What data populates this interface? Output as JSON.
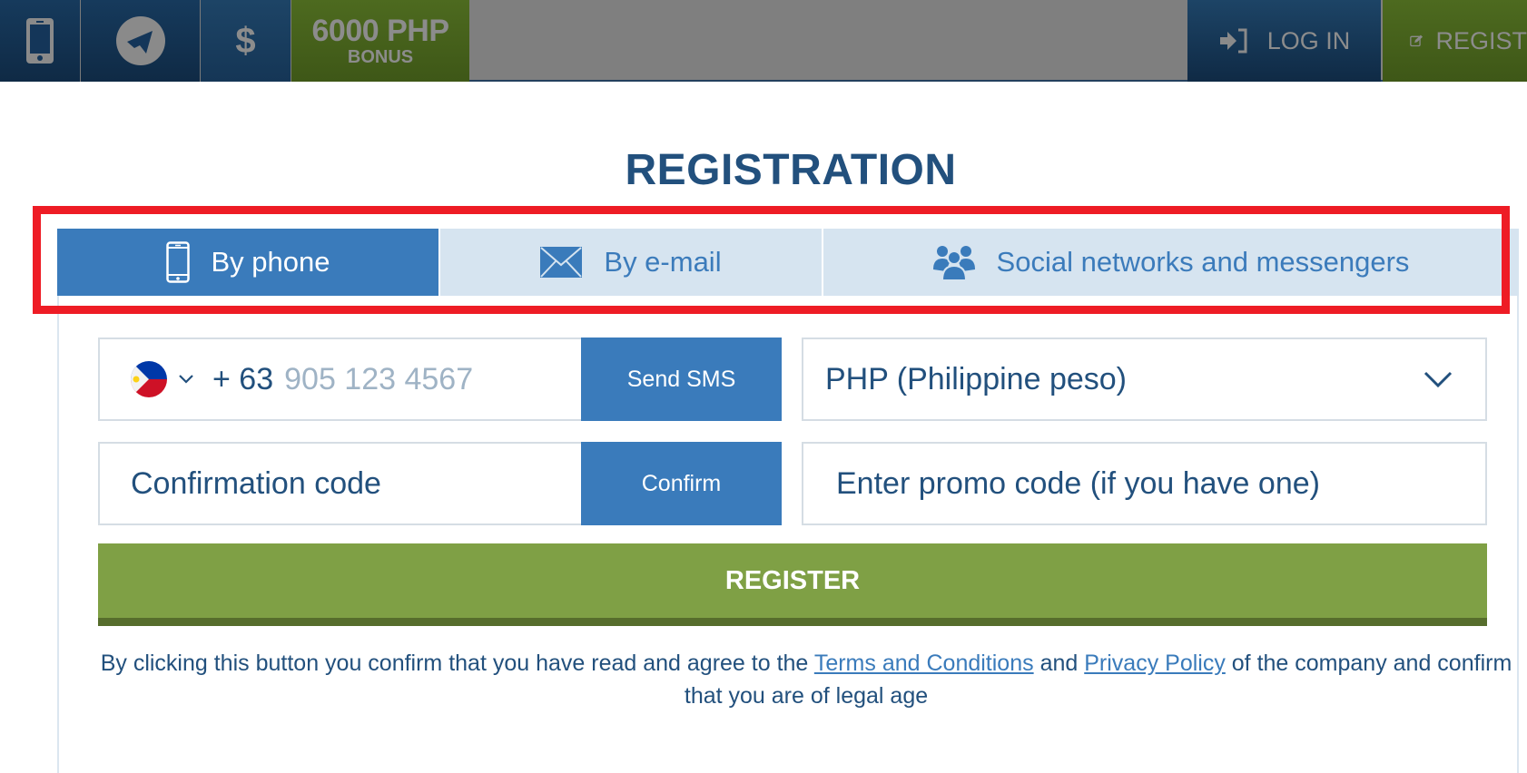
{
  "header": {
    "phone_app_icon": "mobile-phone-icon",
    "telegram_icon": "telegram-icon",
    "dollar_symbol": "$",
    "bonus_amount": "6000 PHP",
    "bonus_label": "BONUS",
    "login_label": "LOG IN",
    "register_label": "REGIST"
  },
  "page": {
    "title": "REGISTRATION"
  },
  "tabs": [
    {
      "label": "By phone",
      "icon": "smartphone-icon",
      "active": true
    },
    {
      "label": "By e-mail",
      "icon": "envelope-icon",
      "active": false
    },
    {
      "label": "Social networks and messengers",
      "icon": "users-icon",
      "active": false
    }
  ],
  "form": {
    "phone": {
      "country": "Philippines",
      "country_code": "+ 63",
      "placeholder": "905 123 4567",
      "send_sms_label": "Send SMS"
    },
    "confirmation": {
      "placeholder": "Confirmation code",
      "confirm_label": "Confirm"
    },
    "currency": {
      "selected": "PHP (Philippine peso)"
    },
    "promo": {
      "placeholder": "Enter promo code (if you have one)"
    },
    "register_label": "REGISTER"
  },
  "terms": {
    "prefix": "By clicking this button you confirm that you have read and agree to the ",
    "terms_link": "Terms and Conditions",
    "middle": " and ",
    "privacy_link": "Privacy Policy",
    "suffix": " of the company and confirm that you are of legal age"
  },
  "colors": {
    "primary_blue": "#3a7bbb",
    "title_blue": "#22507d",
    "tab_inactive_bg": "#d6e4f0",
    "register_green": "#7fa045",
    "highlight_red": "#ee1c25"
  }
}
